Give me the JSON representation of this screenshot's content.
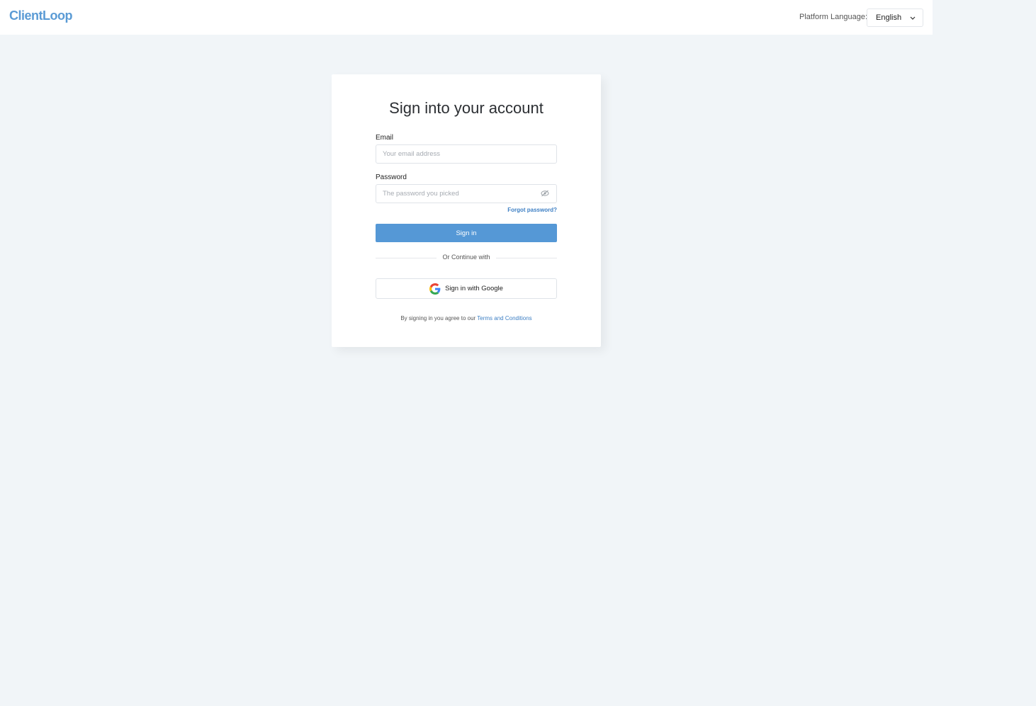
{
  "header": {
    "logo_text_1": "Client",
    "logo_text_2": "Loop",
    "language_label": "Platform Language:",
    "language_value": "English"
  },
  "login": {
    "title": "Sign into your account",
    "email_label": "Email",
    "email_placeholder": "Your email address",
    "email_value": "",
    "password_label": "Password",
    "password_placeholder": "The password you picked",
    "password_value": "",
    "forgot_label": "Forgot password?",
    "signin_label": "Sign in",
    "divider_text": "Or Continue with",
    "google_label": "Sign in with Google",
    "terms_prefix": "By signing in you agree to our",
    "terms_link": "Terms and Conditions"
  },
  "colors": {
    "accent": "#5598d6",
    "link": "#3d7fc4",
    "background": "#f1f5f8"
  },
  "icons": {
    "language_chevron": "chevron-down-icon",
    "password_toggle": "eye-off-icon",
    "google": "google-g-icon"
  }
}
